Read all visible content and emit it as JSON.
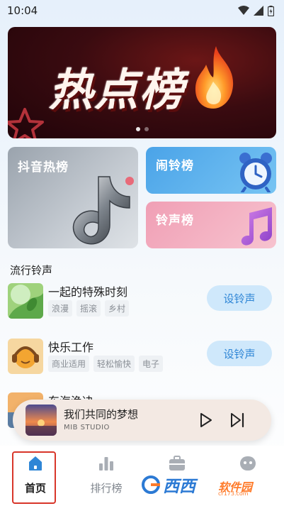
{
  "status_bar": {
    "time": "10:04"
  },
  "banner": {
    "title": "热点榜",
    "slide_count": 2,
    "active_slide": 1
  },
  "categories": {
    "douyin": "抖音热榜",
    "alarm": "闹铃榜",
    "ringtone": "铃声榜"
  },
  "section": {
    "title": "流行铃声"
  },
  "songs": [
    {
      "name": "一起的特殊时刻",
      "tags": [
        "浪漫",
        "摇滚",
        "乡村"
      ],
      "button": "设铃声"
    },
    {
      "name": "快乐工作",
      "tags": [
        "商业适用",
        "轻松愉快",
        "电子"
      ],
      "button": "设铃声"
    },
    {
      "name": "东海渔决"
    }
  ],
  "player": {
    "title": "我们共同的梦想",
    "artist": "MIB STUDIO"
  },
  "tabs": [
    {
      "label": "首页",
      "icon": "home-icon",
      "active": true
    },
    {
      "label": "排行榜",
      "icon": "bar-chart-icon",
      "active": false
    },
    {
      "label": "",
      "icon": "briefcase-icon",
      "active": false
    },
    {
      "label": "",
      "icon": "face-icon",
      "active": false
    }
  ],
  "watermark": {
    "text": "西西",
    "sub": "软件园",
    "url": "cr173.com"
  },
  "colors": {
    "accent": "#2f86d6",
    "button_bg": "#cfe8fb",
    "highlight_frame": "#d8362a"
  }
}
